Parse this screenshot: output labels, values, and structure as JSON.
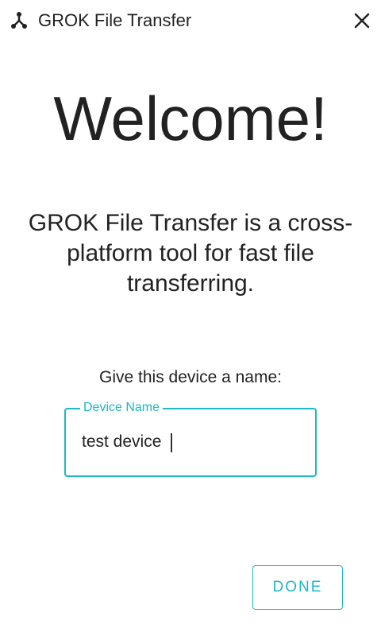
{
  "titlebar": {
    "app_icon": "network-share-icon",
    "title": "GROK File Transfer",
    "close_icon": "close-icon"
  },
  "main": {
    "welcome": "Welcome!",
    "description": "GROK File Transfer is a cross-platform tool for fast file transferring.",
    "prompt": "Give this device a name:"
  },
  "device_field": {
    "label": "Device Name",
    "value": "test device"
  },
  "actions": {
    "done_label": "DONE"
  },
  "colors": {
    "accent": "#1bb8c8",
    "text": "#222222",
    "background": "#ffffff"
  }
}
